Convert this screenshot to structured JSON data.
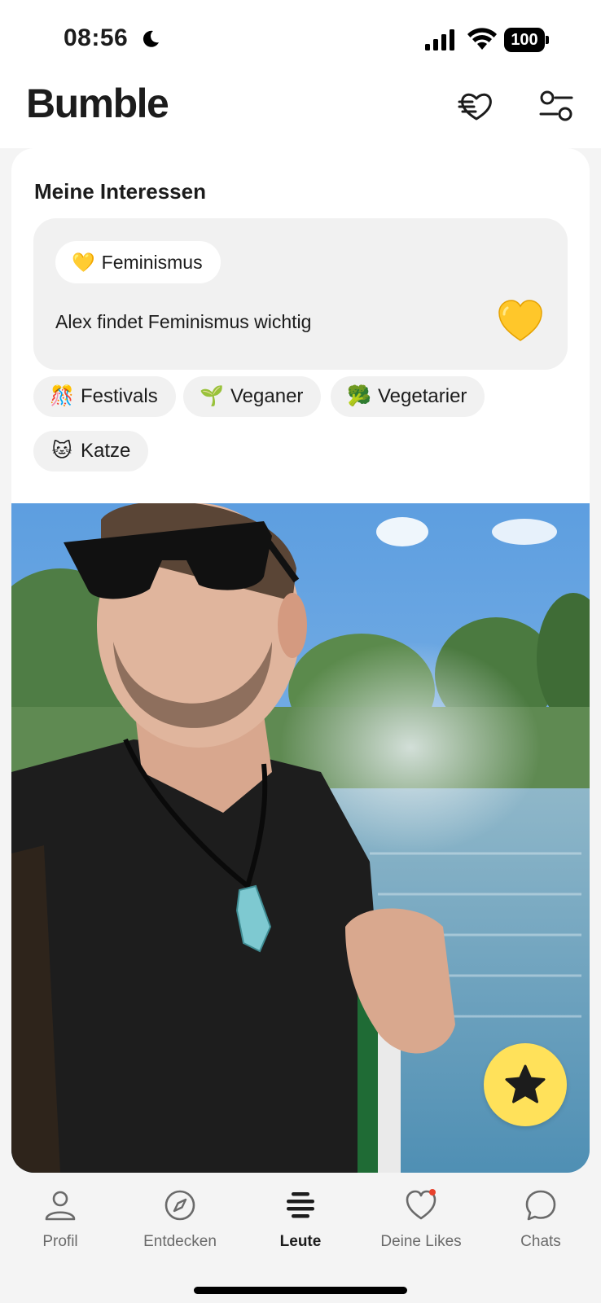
{
  "status_bar": {
    "time": "08:56",
    "battery": "100"
  },
  "app": {
    "title": "Bumble"
  },
  "header": {
    "icons": [
      "heart-lines-icon",
      "filter-icon"
    ]
  },
  "interests": {
    "title": "Meine Interessen",
    "highlight": {
      "chip_emoji": "💛",
      "chip_label": "Feminismus",
      "text": "Alex findet Feminismus wichtig",
      "big_emoji": "💛"
    },
    "chips": [
      {
        "emoji": "🎊",
        "label": "Festivals"
      },
      {
        "emoji": "🌱",
        "label": "Veganer"
      },
      {
        "emoji": "🥦",
        "label": "Vegetarier"
      },
      {
        "emoji": "🐱",
        "label": "Katze"
      }
    ]
  },
  "fab": {
    "icon": "star-icon"
  },
  "nav": {
    "items": [
      {
        "label": "Profil",
        "icon": "person-icon"
      },
      {
        "label": "Entdecken",
        "icon": "compass-icon"
      },
      {
        "label": "Leute",
        "icon": "people-lines-icon",
        "active": true
      },
      {
        "label": "Deine Likes",
        "icon": "heart-icon",
        "badge": true
      },
      {
        "label": "Chats",
        "icon": "chat-bubble-icon"
      }
    ]
  },
  "colors": {
    "accent": "#ffe15a",
    "badge": "#e8412c",
    "text": "#1c1c1c"
  }
}
